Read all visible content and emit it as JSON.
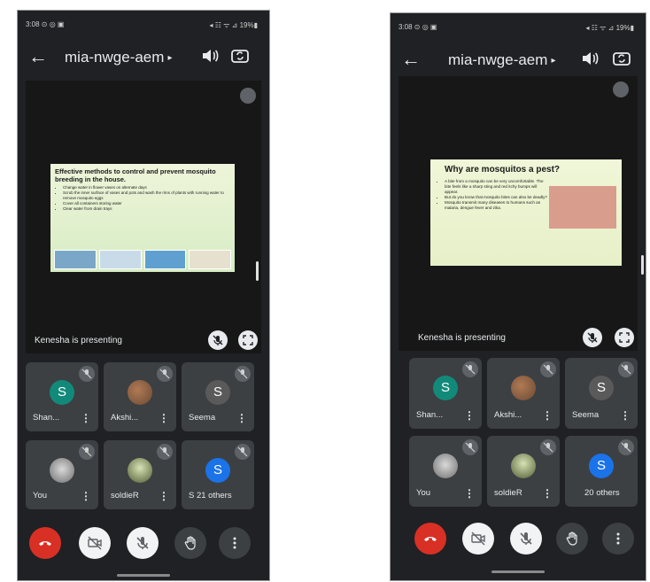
{
  "left": {
    "status_time": "3:08 ⊙ ◎ ▣",
    "status_right": "◂ ☷ ᯤ ⊿ 19%▮",
    "meeting_code": "mia-nwge-aem",
    "slide_title": "Effective methods to control and prevent mosquito breeding in the house.",
    "slide_bullets": [
      "Change water in flower vases on alternate days",
      "Scrub the inner surface of vases and pots and wash the rims of plants with running water to remove mosquito eggs",
      "Cover all containers storing water",
      "Clear water from drain trays"
    ],
    "presenting_text": "Kenesha is presenting",
    "tiles": [
      {
        "name": "Shan...",
        "avatar_letter": "S"
      },
      {
        "name": "Akshi...",
        "avatar_letter": ""
      },
      {
        "name": "Seema",
        "avatar_letter": "S"
      },
      {
        "name": "You",
        "avatar_letter": ""
      },
      {
        "name": "soldieR",
        "avatar_letter": ""
      },
      {
        "name": "S 21 others",
        "avatar_letter": "S"
      }
    ]
  },
  "right": {
    "status_time": "3:08 ⊙ ◎ ▣",
    "status_right": "◂ ☷ ᯤ ⊿ 19%▮",
    "meeting_code": "mia-nwge-aem",
    "slide_title": "Why are mosquitos a pest?",
    "slide_bullets": [
      "A bite from a mosquito can be very uncomfortable. The bite feels like a sharp sting and red itchy bumps will appear.",
      "But do you know that mosquito bites can also be deadly?",
      "Mosquito transmit many diseases to humans such as malaria, dengue fever and zika."
    ],
    "presenting_text": "Kenesha is presenting",
    "tiles": [
      {
        "name": "Shan...",
        "avatar_letter": "S"
      },
      {
        "name": "Akshi...",
        "avatar_letter": ""
      },
      {
        "name": "Seema",
        "avatar_letter": "S"
      },
      {
        "name": "You",
        "avatar_letter": ""
      },
      {
        "name": "soldieR",
        "avatar_letter": ""
      },
      {
        "name": "20 others",
        "avatar_letter": "S"
      }
    ]
  },
  "icons": {
    "back": "arrow-left",
    "caret": "triangle-right",
    "speaker": "volume",
    "switch_camera": "camera-switch",
    "mic_off": "mic-off",
    "fullscreen": "fullscreen",
    "end_call": "phone-hangup",
    "camera_off": "camera-off",
    "raise_hand": "hand",
    "more": "more-vertical"
  },
  "colors": {
    "background": "#202124",
    "tile": "#3c4043",
    "end_call": "#d93025",
    "avatar_teal": "#128a7a",
    "avatar_blue": "#1a73e8"
  }
}
